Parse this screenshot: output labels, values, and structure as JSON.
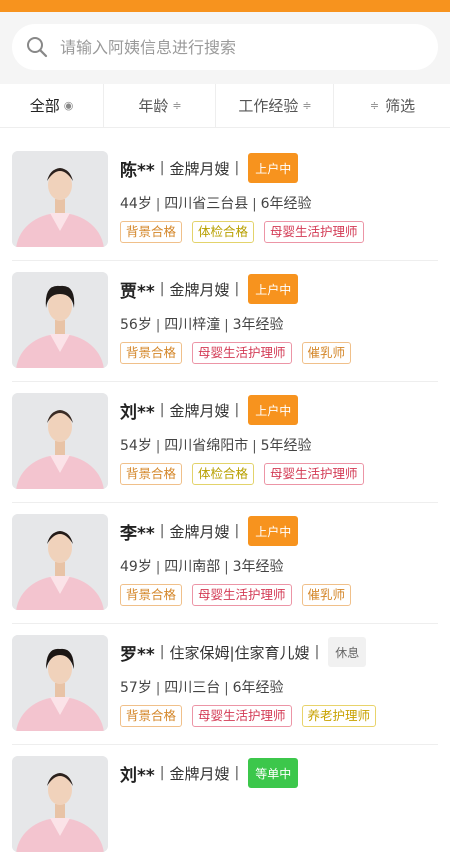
{
  "search": {
    "placeholder": "请输入阿姨信息进行搜索"
  },
  "filters": [
    {
      "label": "全部",
      "icon": "dot-icon"
    },
    {
      "label": "年龄",
      "icon": "sort-icon"
    },
    {
      "label": "工作经验",
      "icon": "sort-icon"
    },
    {
      "label": "筛选",
      "icon": "filter-icon"
    }
  ],
  "nannies": [
    {
      "name": "陈**",
      "role": "金牌月嫂",
      "status": "上户中",
      "age": "44岁",
      "location": "四川省三台县",
      "experience": "6年经验",
      "tags": [
        "背景合格",
        "体检合格",
        "母婴生活护理师"
      ]
    },
    {
      "name": "贾**",
      "role": "金牌月嫂",
      "status": "上户中",
      "age": "56岁",
      "location": "四川梓潼",
      "experience": "3年经验",
      "tags": [
        "背景合格",
        "母婴生活护理师",
        "催乳师"
      ]
    },
    {
      "name": "刘**",
      "role": "金牌月嫂",
      "status": "上户中",
      "age": "54岁",
      "location": "四川省绵阳市",
      "experience": "5年经验",
      "tags": [
        "背景合格",
        "体检合格",
        "母婴生活护理师"
      ]
    },
    {
      "name": "李**",
      "role": "金牌月嫂",
      "status": "上户中",
      "age": "49岁",
      "location": "四川南部",
      "experience": "3年经验",
      "tags": [
        "背景合格",
        "母婴生活护理师",
        "催乳师"
      ]
    },
    {
      "name": "罗**",
      "role": "住家保姆|住家育儿嫂",
      "status": "休息",
      "age": "57岁",
      "location": "四川三台",
      "experience": "6年经验",
      "tags": [
        "背景合格",
        "母婴生活护理师",
        "养老护理师"
      ]
    },
    {
      "name": "刘**",
      "role": "金牌月嫂",
      "status": "等单中",
      "age": "",
      "location": "",
      "experience": "",
      "tags": []
    }
  ],
  "colors": {
    "accent": "#f7931e",
    "status_busy": "#f7931e",
    "status_waiting": "#3cc74b",
    "status_rest": "#f1f1f1"
  }
}
